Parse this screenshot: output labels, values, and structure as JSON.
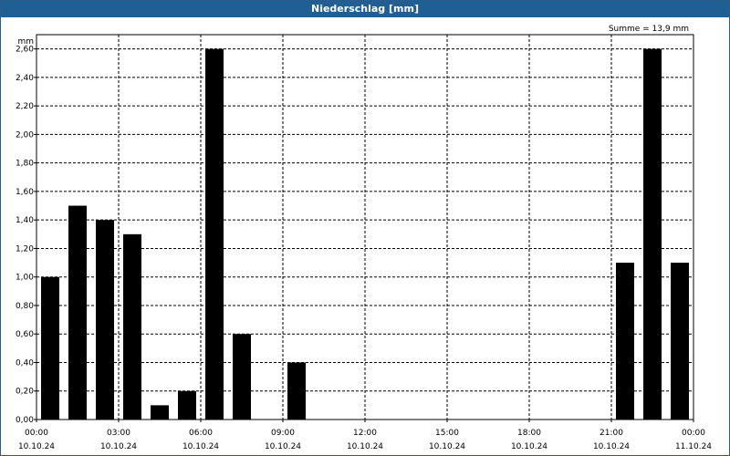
{
  "window": {
    "title": "Niederschlag [mm]"
  },
  "chart_data": {
    "type": "bar",
    "title": "Niederschlag [mm]",
    "ylabel": "mm",
    "annotation": "Summe = 13,9 mm",
    "ylim": [
      0,
      2.7
    ],
    "yticks": [
      "0,00",
      "0,20",
      "0,40",
      "0,60",
      "0,80",
      "1,00",
      "1,20",
      "1,40",
      "1,60",
      "1,80",
      "2,00",
      "2,20",
      "2,40",
      "2,60"
    ],
    "ytick_values": [
      0,
      0.2,
      0.4,
      0.6,
      0.8,
      1.0,
      1.2,
      1.4,
      1.6,
      1.8,
      2.0,
      2.2,
      2.4,
      2.6
    ],
    "xticks": [
      {
        "time": "00:00",
        "date": "10.10.24",
        "hour": 0
      },
      {
        "time": "03:00",
        "date": "10.10.24",
        "hour": 3
      },
      {
        "time": "06:00",
        "date": "10.10.24",
        "hour": 6
      },
      {
        "time": "09:00",
        "date": "10.10.24",
        "hour": 9
      },
      {
        "time": "12:00",
        "date": "10.10.24",
        "hour": 12
      },
      {
        "time": "15:00",
        "date": "10.10.24",
        "hour": 15
      },
      {
        "time": "18:00",
        "date": "10.10.24",
        "hour": 18
      },
      {
        "time": "21:00",
        "date": "10.10.24",
        "hour": 21
      },
      {
        "time": "00:00",
        "date": "11.10.24",
        "hour": 24
      }
    ],
    "hours": [
      0,
      1,
      2,
      3,
      4,
      5,
      6,
      7,
      8,
      9,
      10,
      11,
      12,
      13,
      14,
      15,
      16,
      17,
      18,
      19,
      20,
      21,
      22,
      23
    ],
    "values": [
      1.0,
      1.5,
      1.4,
      1.3,
      0.1,
      0.2,
      2.6,
      0.6,
      0,
      0.4,
      0,
      0,
      0,
      0,
      0,
      0,
      0,
      0,
      0,
      0,
      0,
      1.1,
      2.6,
      1.1
    ],
    "bar_color": "#000000",
    "grid": true
  }
}
